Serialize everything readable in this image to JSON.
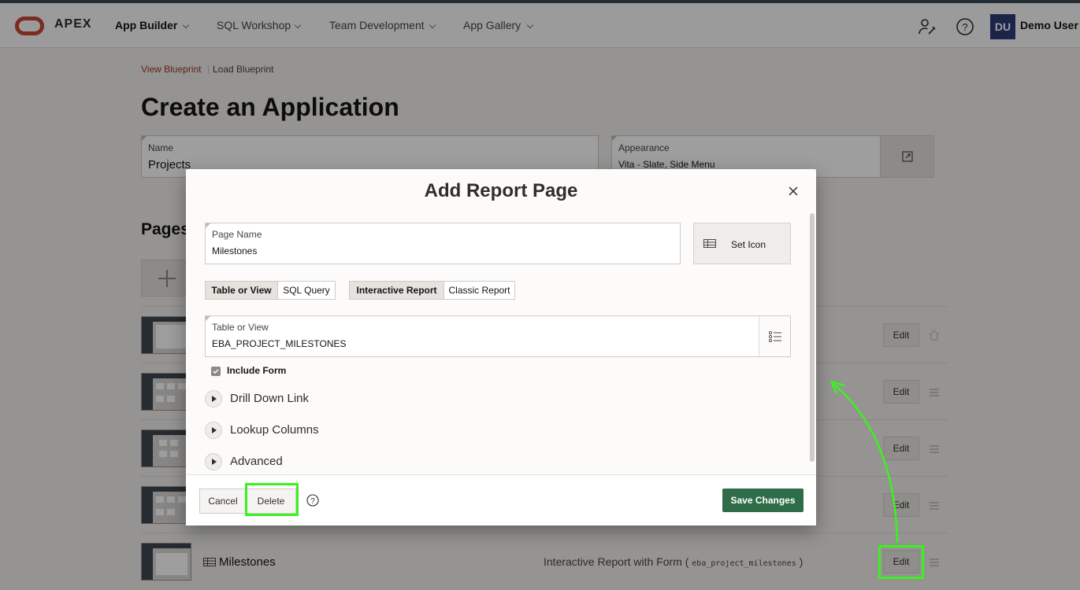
{
  "header": {
    "logo_text": "APEX",
    "nav": [
      "App Builder",
      "SQL Workshop",
      "Team Development",
      "App Gallery"
    ],
    "avatar": "DU",
    "user": "Demo User"
  },
  "breadcrumb": {
    "view": "View Blueprint",
    "load": "Load Blueprint"
  },
  "page_title": "Create an Application",
  "name_field": {
    "label": "Name",
    "value": "Projects"
  },
  "appearance_field": {
    "label": "Appearance",
    "value": "Vita - Slate, Side Menu"
  },
  "pages_heading": "Pages",
  "rows": {
    "edit_label": "Edit",
    "last_name": "Milestones",
    "last_type": "Interactive Report with Form (",
    "last_table": "eba_project_milestones",
    "last_close": ")"
  },
  "dialog": {
    "title": "Add Report Page",
    "page_name_label": "Page Name",
    "page_name_value": "Milestones",
    "set_icon": "Set Icon",
    "source_options": [
      "Table or View",
      "SQL Query"
    ],
    "report_options": [
      "Interactive Report",
      "Classic Report"
    ],
    "table_label": "Table or View",
    "table_value": "EBA_PROJECT_MILESTONES",
    "include_form": "Include Form",
    "sections": [
      "Drill Down Link",
      "Lookup Columns",
      "Advanced"
    ],
    "cancel": "Cancel",
    "delete": "Delete",
    "save": "Save Changes"
  },
  "colors": {
    "accent_red": "#c74634",
    "save_green": "#2f6d48",
    "highlight": "#3bf21e"
  }
}
